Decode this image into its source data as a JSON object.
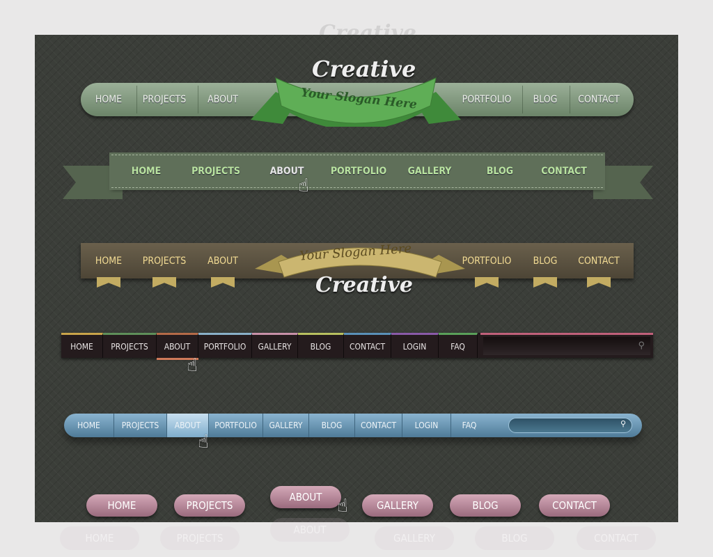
{
  "nav1": {
    "left": [
      "HOME",
      "PROJECTS",
      "ABOUT"
    ],
    "right": [
      "PORTFOLIO",
      "BLOG",
      "CONTACT"
    ],
    "title": "Creative",
    "slogan": "Your Slogan Here"
  },
  "nav2": {
    "items": [
      "HOME",
      "PROJECTS",
      "ABOUT",
      "PORTFOLIO",
      "GALLERY",
      "BLOG",
      "CONTACT"
    ],
    "active": "ABOUT"
  },
  "nav3": {
    "left": [
      "HOME",
      "PROJECTS",
      "ABOUT"
    ],
    "right": [
      "PORTFOLIO",
      "BLOG",
      "CONTACT"
    ],
    "title": "Creative",
    "slogan": "Your Slogan Here"
  },
  "nav4": {
    "items": [
      "HOME",
      "PROJECTS",
      "ABOUT",
      "PORTFOLIO",
      "GALLERY",
      "BLOG",
      "CONTACT",
      "LOGIN",
      "FAQ"
    ],
    "strip_colors": [
      "#c9a44a",
      "#5f8f5a",
      "#b56a48",
      "#8ab0c8",
      "#c890a8",
      "#b8c060",
      "#5a90b8",
      "#8a5aa8",
      "#5aa05a"
    ],
    "search_color": "#c0607a",
    "active": "ABOUT",
    "search_icon": "magnifier-icon"
  },
  "nav5": {
    "items": [
      "HOME",
      "PROJECTS",
      "ABOUT",
      "PORTFOLIO",
      "GALLERY",
      "BLOG",
      "CONTACT",
      "LOGIN",
      "FAQ"
    ],
    "active": "ABOUT",
    "search_icon": "magnifier-icon"
  },
  "nav6": {
    "items": [
      "HOME",
      "PROJECTS",
      "ABOUT",
      "GALLERY",
      "BLOG",
      "CONTACT"
    ],
    "active": "ABOUT"
  },
  "cursor_icon": "hand-pointer-icon"
}
